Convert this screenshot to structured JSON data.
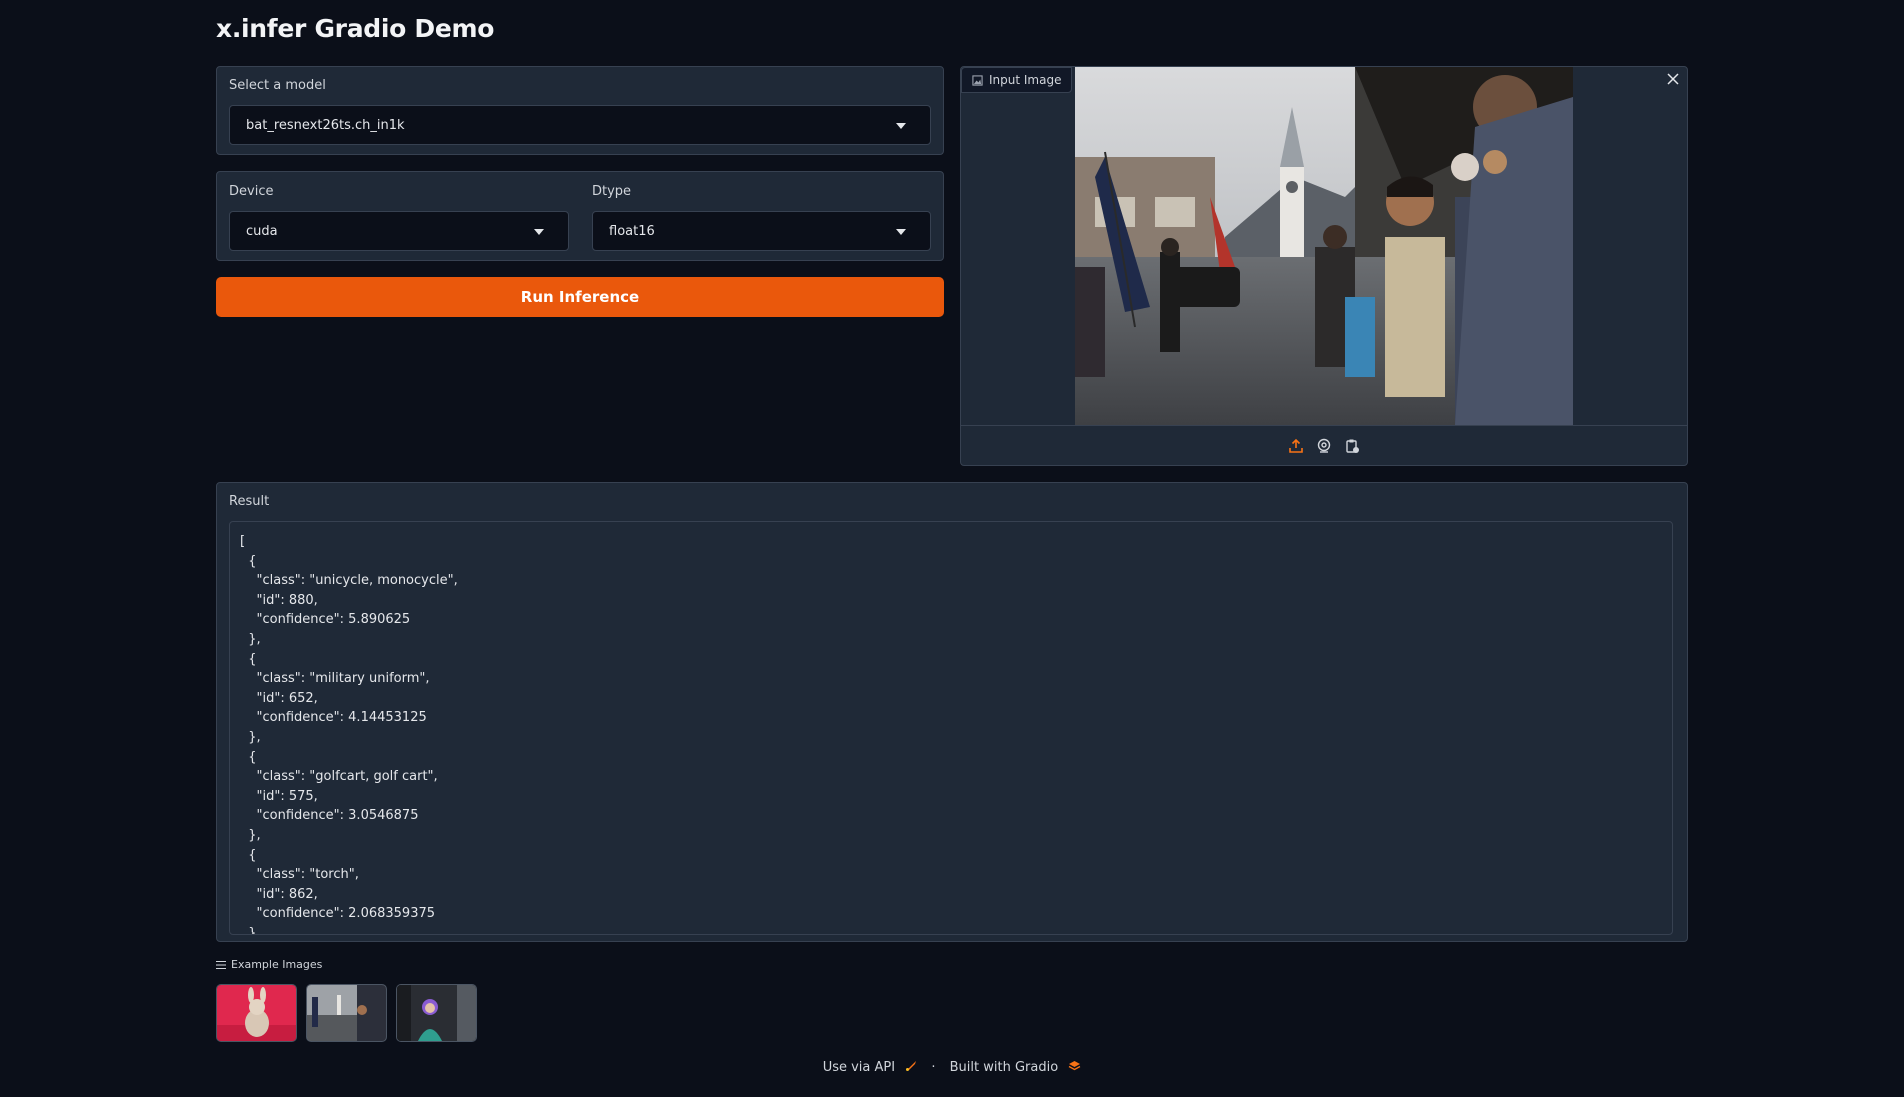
{
  "app": {
    "title": "x.infer Gradio Demo"
  },
  "model_select": {
    "label": "Select a model",
    "value": "bat_resnext26ts.ch_in1k"
  },
  "device_select": {
    "label": "Device",
    "value": "cuda"
  },
  "dtype_select": {
    "label": "Dtype",
    "value": "float16"
  },
  "run_button": {
    "label": "Run Inference"
  },
  "input_image": {
    "label": "Input Image",
    "tools": [
      "upload-icon",
      "webcam-icon",
      "clipboard-icon"
    ]
  },
  "result": {
    "label": "Result",
    "text": "[\n  {\n    \"class\": \"unicycle, monocycle\",\n    \"id\": 880,\n    \"confidence\": 5.890625\n  },\n  {\n    \"class\": \"military uniform\",\n    \"id\": 652,\n    \"confidence\": 4.14453125\n  },\n  {\n    \"class\": \"golfcart, golf cart\",\n    \"id\": 575,\n    \"confidence\": 3.0546875\n  },\n  {\n    \"class\": \"torch\",\n    \"id\": 862,\n    \"confidence\": 2.068359375\n  },"
  },
  "examples": {
    "label": "Example Images"
  },
  "footer": {
    "api_label": "Use via API",
    "separator": "·",
    "built_label": "Built with Gradio"
  },
  "colors": {
    "accent": "#ea580c",
    "background": "#0b0f19",
    "panel": "#1f2937"
  }
}
